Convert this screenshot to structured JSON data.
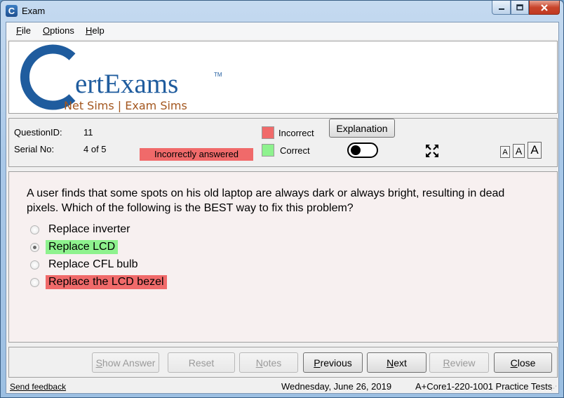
{
  "window": {
    "title": "Exam",
    "app_icon_glyph": "C"
  },
  "menu": {
    "file": {
      "accel": "F",
      "rest": "ile"
    },
    "options": {
      "accel": "O",
      "rest": "ptions"
    },
    "help": {
      "accel": "H",
      "rest": "elp"
    }
  },
  "logo": {
    "brand": "ertExams",
    "trademark": "TM",
    "tagline": "Net Sims | Exam Sims",
    "colors": {
      "primary": "#1f5c9e",
      "tagline": "#a3561e"
    }
  },
  "info": {
    "question_id_label": "QuestionID:",
    "question_id_value": "11",
    "serial_label": "Serial No:",
    "serial_value": "4 of 5",
    "status_badge": "Incorrectly answered",
    "legend_incorrect": "Incorrect",
    "legend_correct": "Correct",
    "explanation_button": "Explanation",
    "font_small": "A",
    "font_medium": "A",
    "font_large": "A",
    "expand_icon": "expand-arrows-icon",
    "colors": {
      "incorrect": "#f06a6a",
      "correct": "#8ef28e"
    }
  },
  "question": {
    "text": "A user finds that some spots on his old laptop are always dark or always bright, resulting in dead pixels. Which of the following is the BEST way to fix this problem?",
    "options": [
      {
        "label": "Replace inverter",
        "state": "none",
        "selected": false
      },
      {
        "label": "Replace LCD",
        "state": "correct",
        "selected": true
      },
      {
        "label": "Replace CFL bulb",
        "state": "none",
        "selected": false
      },
      {
        "label": "Replace the LCD bezel",
        "state": "incorrect",
        "selected": false
      }
    ]
  },
  "buttons": {
    "show_answer": {
      "accel": "S",
      "rest": "how Answer"
    },
    "reset": {
      "accel": "",
      "rest": "Reset"
    },
    "notes": {
      "accel": "N",
      "rest": "otes"
    },
    "previous": {
      "accel": "P",
      "rest": "revious"
    },
    "next": {
      "accel": "N",
      "rest": "ext"
    },
    "review": {
      "accel": "R",
      "rest": "eview"
    },
    "close": {
      "accel": "C",
      "rest": "lose"
    }
  },
  "footer": {
    "feedback": "Send feedback",
    "date": "Wednesday, June 26, 2019",
    "product": "A+Core1-220-1001 Practice Tests"
  }
}
